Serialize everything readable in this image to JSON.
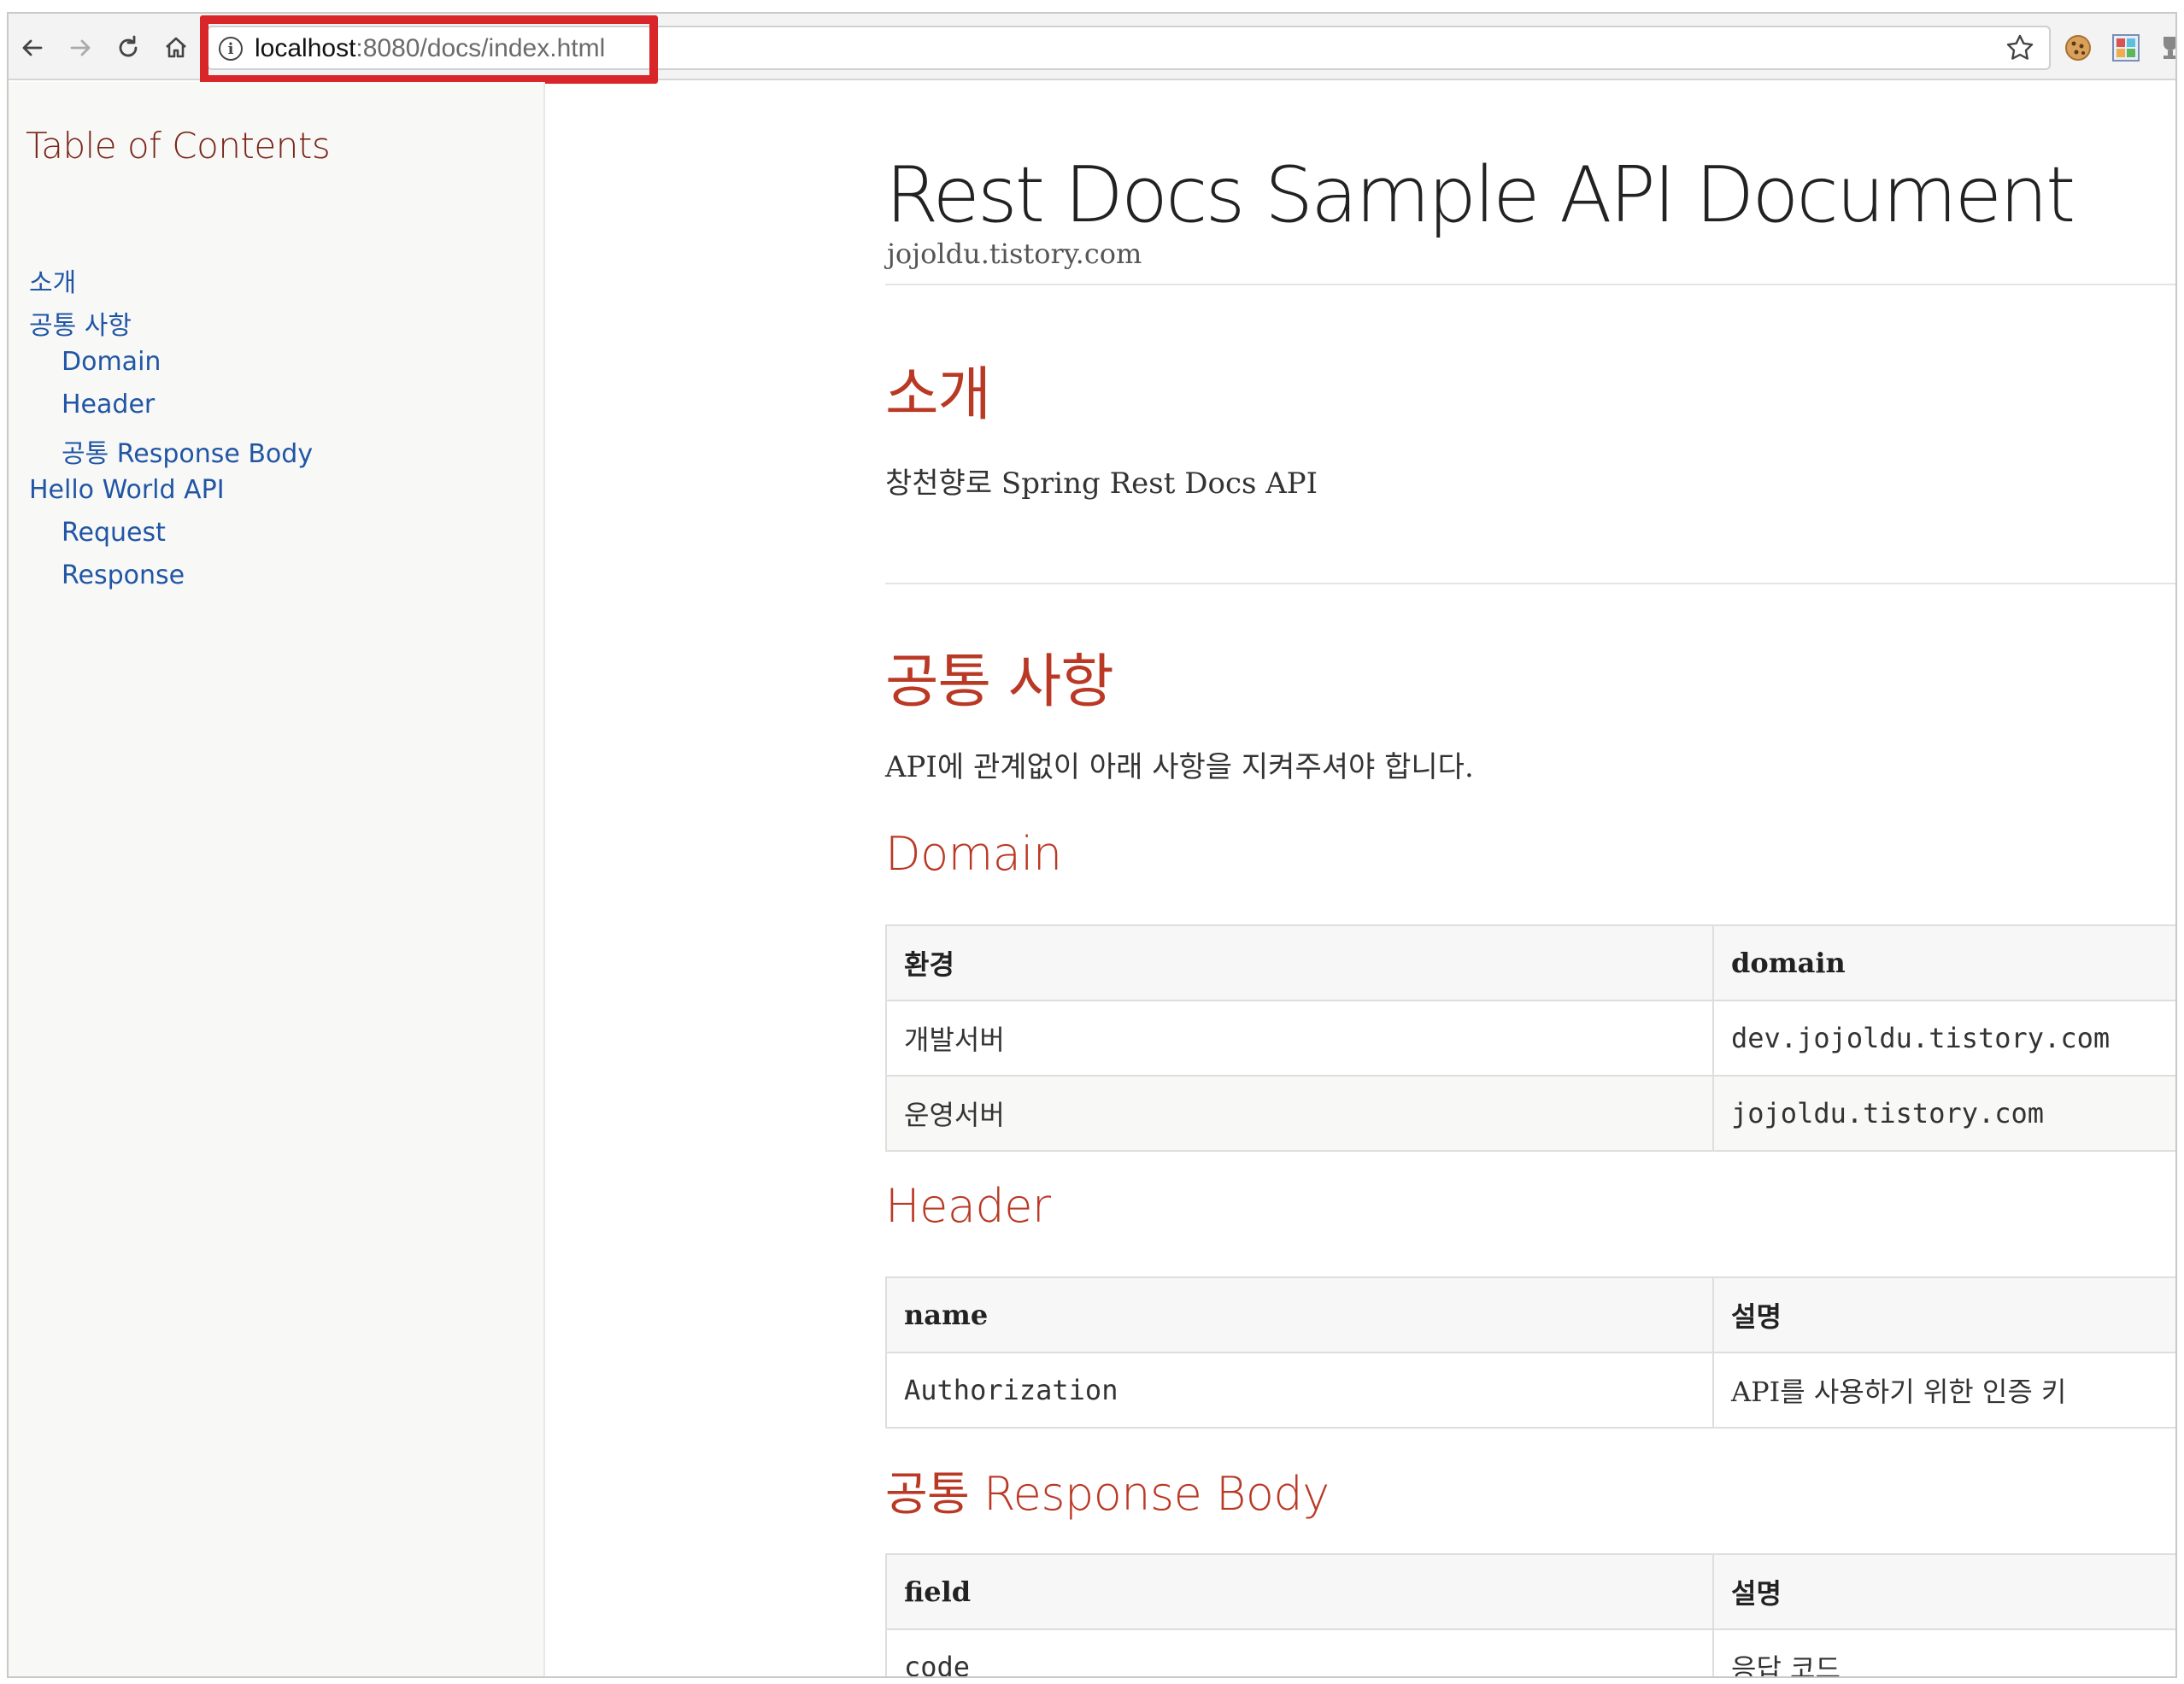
{
  "browser": {
    "url_host": "localhost",
    "url_rest": ":8080/docs/index.html",
    "info_glyph": "i",
    "icons": [
      "back-arrow-icon",
      "forward-arrow-icon",
      "reload-icon",
      "home-icon",
      "info-icon",
      "bookmark-star-icon",
      "cookie-extension-icon",
      "grid-extension-icon",
      "trophy-extension-icon"
    ]
  },
  "toc": {
    "title": "Table of Contents",
    "items": [
      {
        "label": "소개"
      },
      {
        "label": "공통 사항"
      },
      {
        "label": "Domain"
      },
      {
        "label": "Header"
      },
      {
        "label": "공통 Response Body"
      },
      {
        "label": "Hello World API"
      },
      {
        "label": "Request"
      },
      {
        "label": "Response"
      }
    ]
  },
  "doc": {
    "title": "Rest Docs Sample API Document",
    "subtitle": "jojoldu.tistory.com",
    "intro": {
      "heading": "소개",
      "text": "창천향로 Spring Rest Docs API"
    },
    "common": {
      "heading": "공통 사항",
      "text": "API에 관계없이 아래 사항을 지켜주셔야 합니다."
    },
    "domain": {
      "heading": "Domain",
      "headers": [
        "환경",
        "domain"
      ],
      "rows": [
        [
          "개발서버",
          "dev.jojoldu.tistory.com"
        ],
        [
          "운영서버",
          "jojoldu.tistory.com"
        ]
      ]
    },
    "header": {
      "heading": "Header",
      "headers": [
        "name",
        "설명"
      ],
      "rows": [
        [
          "Authorization",
          "API를 사용하기 위한 인증 키"
        ]
      ]
    },
    "response_body": {
      "heading": "공통 Response Body",
      "headers": [
        "field",
        "설명"
      ],
      "rows": [
        [
          "code",
          "응답 코드"
        ]
      ]
    }
  },
  "colors": {
    "heading": "#ba3925",
    "toc_title": "#7a2518",
    "link": "#2156a5",
    "highlight_border": "#d9262a"
  }
}
